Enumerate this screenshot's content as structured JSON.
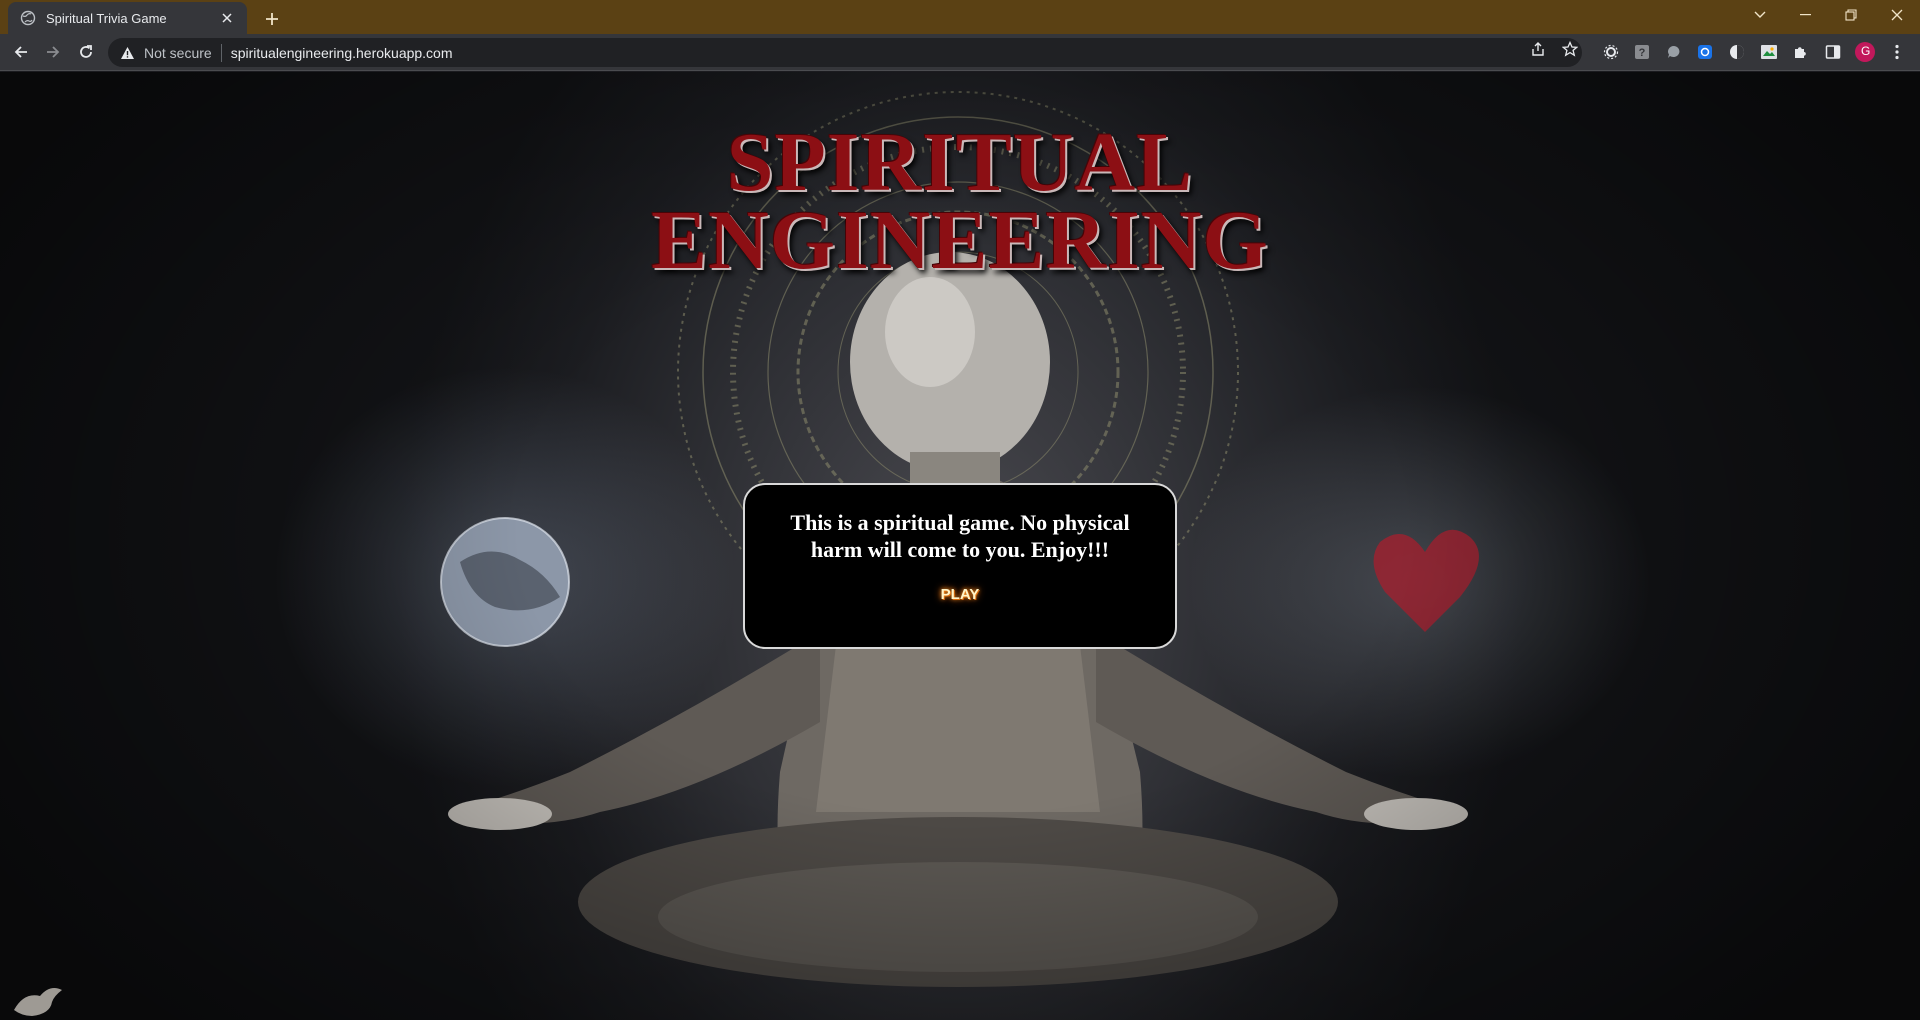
{
  "browser": {
    "tab": {
      "title": "Spiritual Trivia Game"
    },
    "address_bar": {
      "security_label": "Not secure",
      "url": "spiritualengineering.herokuapp.com"
    },
    "profile_initial": "G",
    "colors": {
      "frame": "#5b4114",
      "toolbar": "#35363a",
      "omnibox": "#202124"
    }
  },
  "page": {
    "title_lines": [
      "SPIRITUAL",
      "ENGINEERING"
    ],
    "modal": {
      "message": "This is a spiritual game. No physical harm will come to you. Enjoy!!!",
      "play_label": "PLAY"
    },
    "colors": {
      "title": "#8c0f14",
      "modal_bg": "#000000",
      "play_glow": "#ff6a00"
    }
  }
}
